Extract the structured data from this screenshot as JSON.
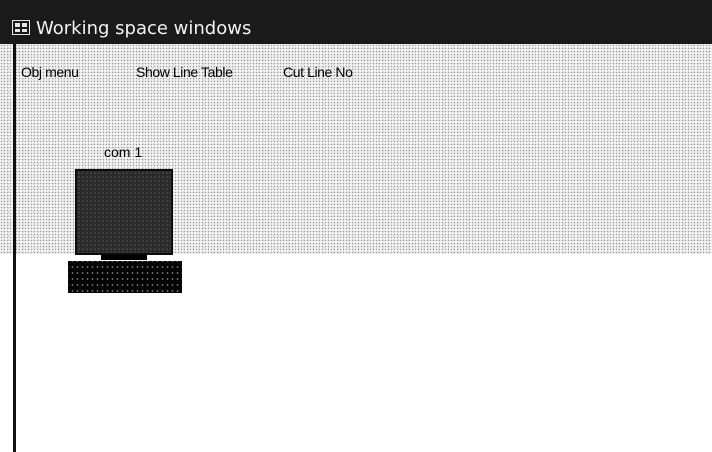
{
  "window": {
    "title": "Working space windows",
    "icon": "app-window-icon"
  },
  "menu": {
    "items": [
      {
        "id": "obj-menu",
        "label": "Obj menu"
      },
      {
        "id": "show-line-table",
        "label": "Show Line Table"
      },
      {
        "id": "cut-line-no",
        "label": "Cut Line No"
      }
    ]
  },
  "canvas": {
    "nodes": [
      {
        "label": "com 1",
        "icon": "computer-icon"
      }
    ]
  },
  "colors": {
    "titlebar": "#1a1a1a",
    "title_text": "#f2f2f2",
    "canvas": "#ffffff"
  }
}
